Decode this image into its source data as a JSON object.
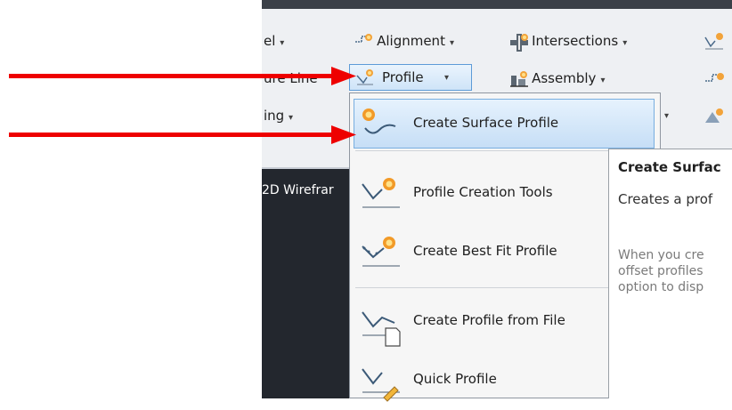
{
  "ribbon": {
    "row1_left_partial": "el",
    "row2_left_partial": "ure Line",
    "row3_left_partial": "ing",
    "alignment": "Alignment",
    "intersections": "Intersections",
    "profile": "Profile",
    "assembly": "Assembly",
    "caret": "▾"
  },
  "viewport": {
    "label": "2D Wirefrar"
  },
  "menu": {
    "items": [
      {
        "label": "Create Surface Profile"
      },
      {
        "label": "Profile Creation Tools"
      },
      {
        "label": "Create Best Fit Profile"
      },
      {
        "label": "Create Profile from File"
      },
      {
        "label": "Quick Profile"
      }
    ]
  },
  "tooltip": {
    "title": "Create Surfac",
    "desc": "Creates a prof",
    "body_lines": [
      "When you cre",
      "offset profiles",
      "option to disp"
    ]
  },
  "colors": {
    "arrow": "#ee0000",
    "highlight": "#c6def6",
    "viewport": "#23272e"
  }
}
